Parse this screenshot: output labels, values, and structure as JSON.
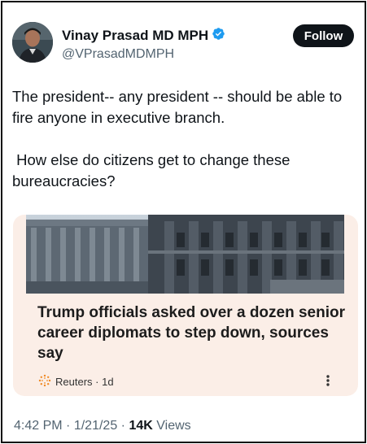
{
  "author": {
    "name": "Vinay Prasad MD MPH",
    "handle": "@VPrasadMDMPH",
    "verified": true
  },
  "follow_label": "Follow",
  "tweet": {
    "text": "The president-- any president -- should be able to fire anyone in executive branch.\n\n How else do citizens get to change these bureaucracies?"
  },
  "card": {
    "headline": "Trump officials asked over a dozen senior career diplomats to step down, sources say",
    "source": "Reuters",
    "age": "1d",
    "background": "#fbeee7"
  },
  "meta": {
    "time": "4:42 PM",
    "date": "1/21/25",
    "views_count": "14K",
    "views_label": "Views"
  },
  "colors": {
    "verified_badge": "#1d9bf0",
    "follow_button": "#0f1419",
    "secondary_text": "#536471"
  }
}
